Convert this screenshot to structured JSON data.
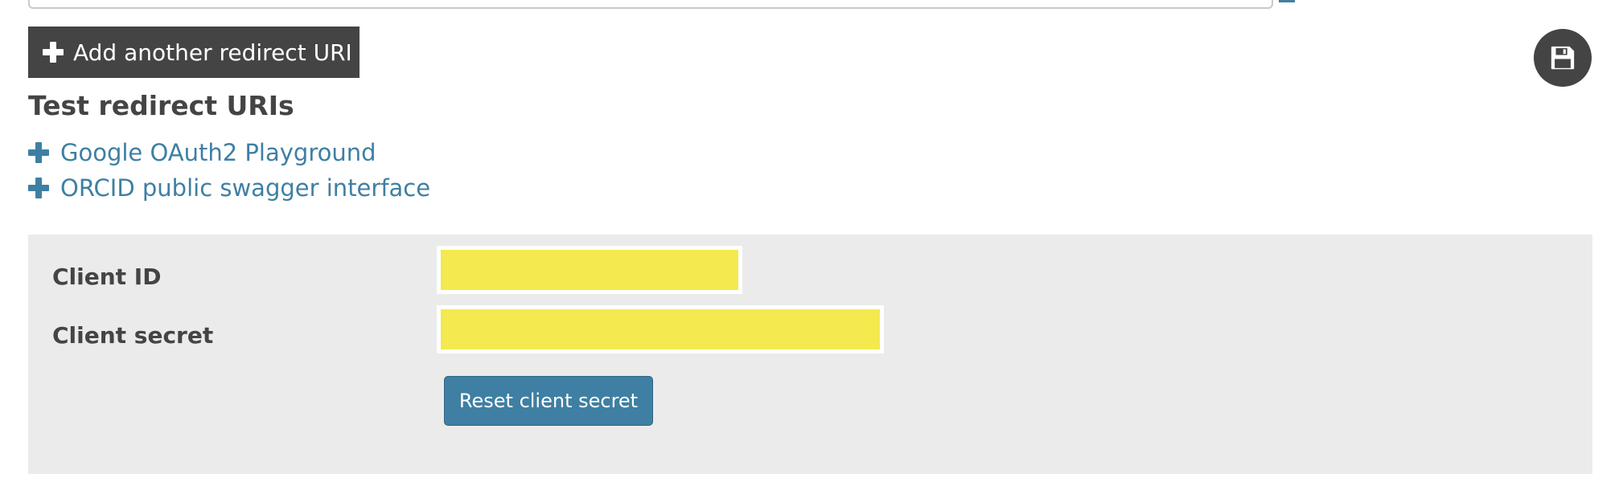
{
  "redirect_uris": {
    "add_button_label": "Add another redirect URI",
    "add_icon": "plus-icon"
  },
  "save": {
    "icon": "floppy-disk-icon"
  },
  "test_redirect_uris": {
    "heading": "Test redirect URIs",
    "links": [
      {
        "label": "Google OAuth2 Playground",
        "icon": "plus-icon"
      },
      {
        "label": "ORCID public swagger interface",
        "icon": "plus-icon"
      }
    ]
  },
  "credentials": {
    "client_id_label": "Client ID",
    "client_secret_label": "Client secret",
    "reset_button_label": "Reset client secret"
  },
  "colors": {
    "dark_button": "#444444",
    "link_blue": "#3f7fa3",
    "panel_background": "#ebebeb",
    "redaction_highlight": "#f4e94e"
  }
}
